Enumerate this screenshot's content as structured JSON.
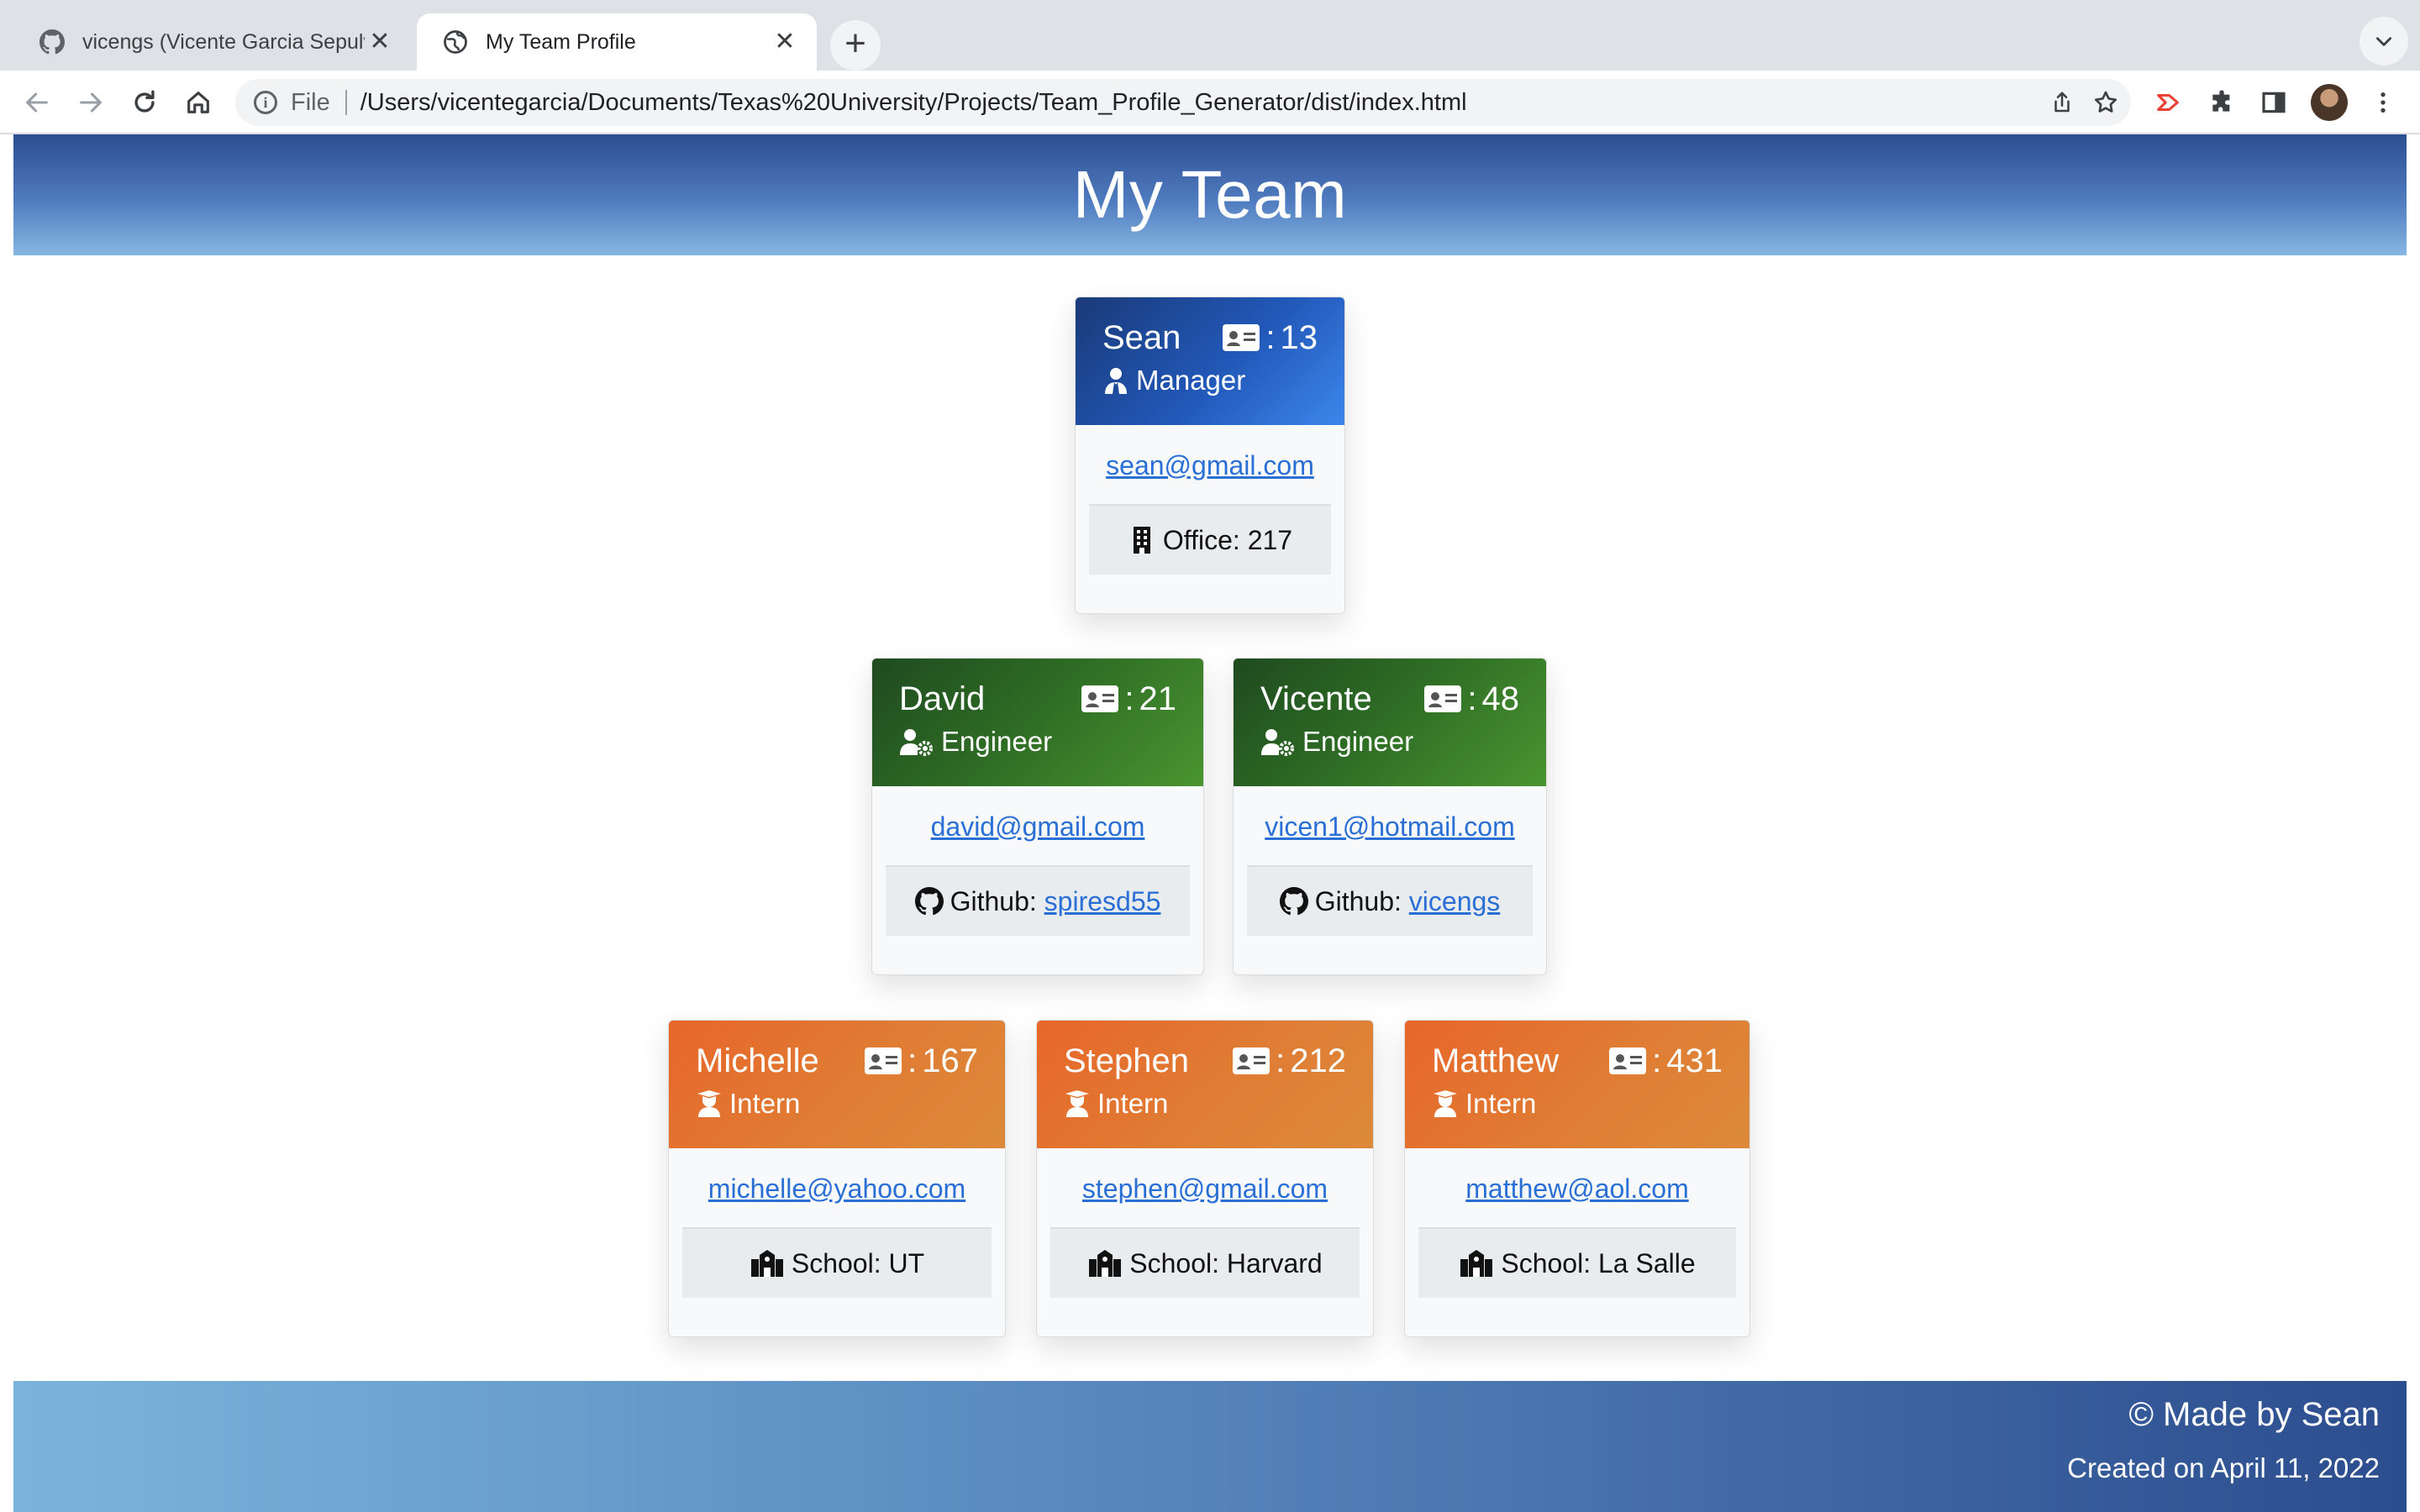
{
  "browser": {
    "tabs": [
      {
        "title": "vicengs (Vicente Garcia Sepulv",
        "icon": "github-icon",
        "active": false
      },
      {
        "title": "My Team Profile",
        "icon": "globe-icon",
        "active": true
      }
    ],
    "new_tab_label": "+",
    "close_label": "✕",
    "address": {
      "scheme": "File",
      "url": "/Users/vicentegarcia/Documents/Texas%20University/Projects/Team_Profile_Generator/dist/index.html"
    }
  },
  "page": {
    "title": "My Team",
    "id_separator": ":",
    "managers": [
      {
        "name": "Sean",
        "id": "13",
        "role": "Manager",
        "email": "sean@gmail.com",
        "extra_label": "Office: 217",
        "extra_link": ""
      }
    ],
    "engineers": [
      {
        "name": "David",
        "id": "21",
        "role": "Engineer",
        "email": "david@gmail.com",
        "extra_label": "Github:",
        "extra_link": "spiresd55"
      },
      {
        "name": "Vicente",
        "id": "48",
        "role": "Engineer",
        "email": "vicen1@hotmail.com",
        "extra_label": "Github:",
        "extra_link": "vicengs"
      }
    ],
    "interns": [
      {
        "name": "Michelle",
        "id": "167",
        "role": "Intern",
        "email": "michelle@yahoo.com",
        "extra_label": "School: UT",
        "extra_link": ""
      },
      {
        "name": "Stephen",
        "id": "212",
        "role": "Intern",
        "email": "stephen@gmail.com",
        "extra_label": "School: Harvard",
        "extra_link": ""
      },
      {
        "name": "Matthew",
        "id": "431",
        "role": "Intern",
        "email": "matthew@aol.com",
        "extra_label": "School: La Salle",
        "extra_link": ""
      }
    ],
    "footer": {
      "line1": "© Made by Sean",
      "line2": "Created on April 11, 2022"
    }
  },
  "colors": {
    "header_blue": "#2c4e90",
    "manager_blue": "#2158b8",
    "engineer_green": "#2f6f25",
    "intern_orange": "#e07b33",
    "link_blue": "#2a6fd6"
  }
}
